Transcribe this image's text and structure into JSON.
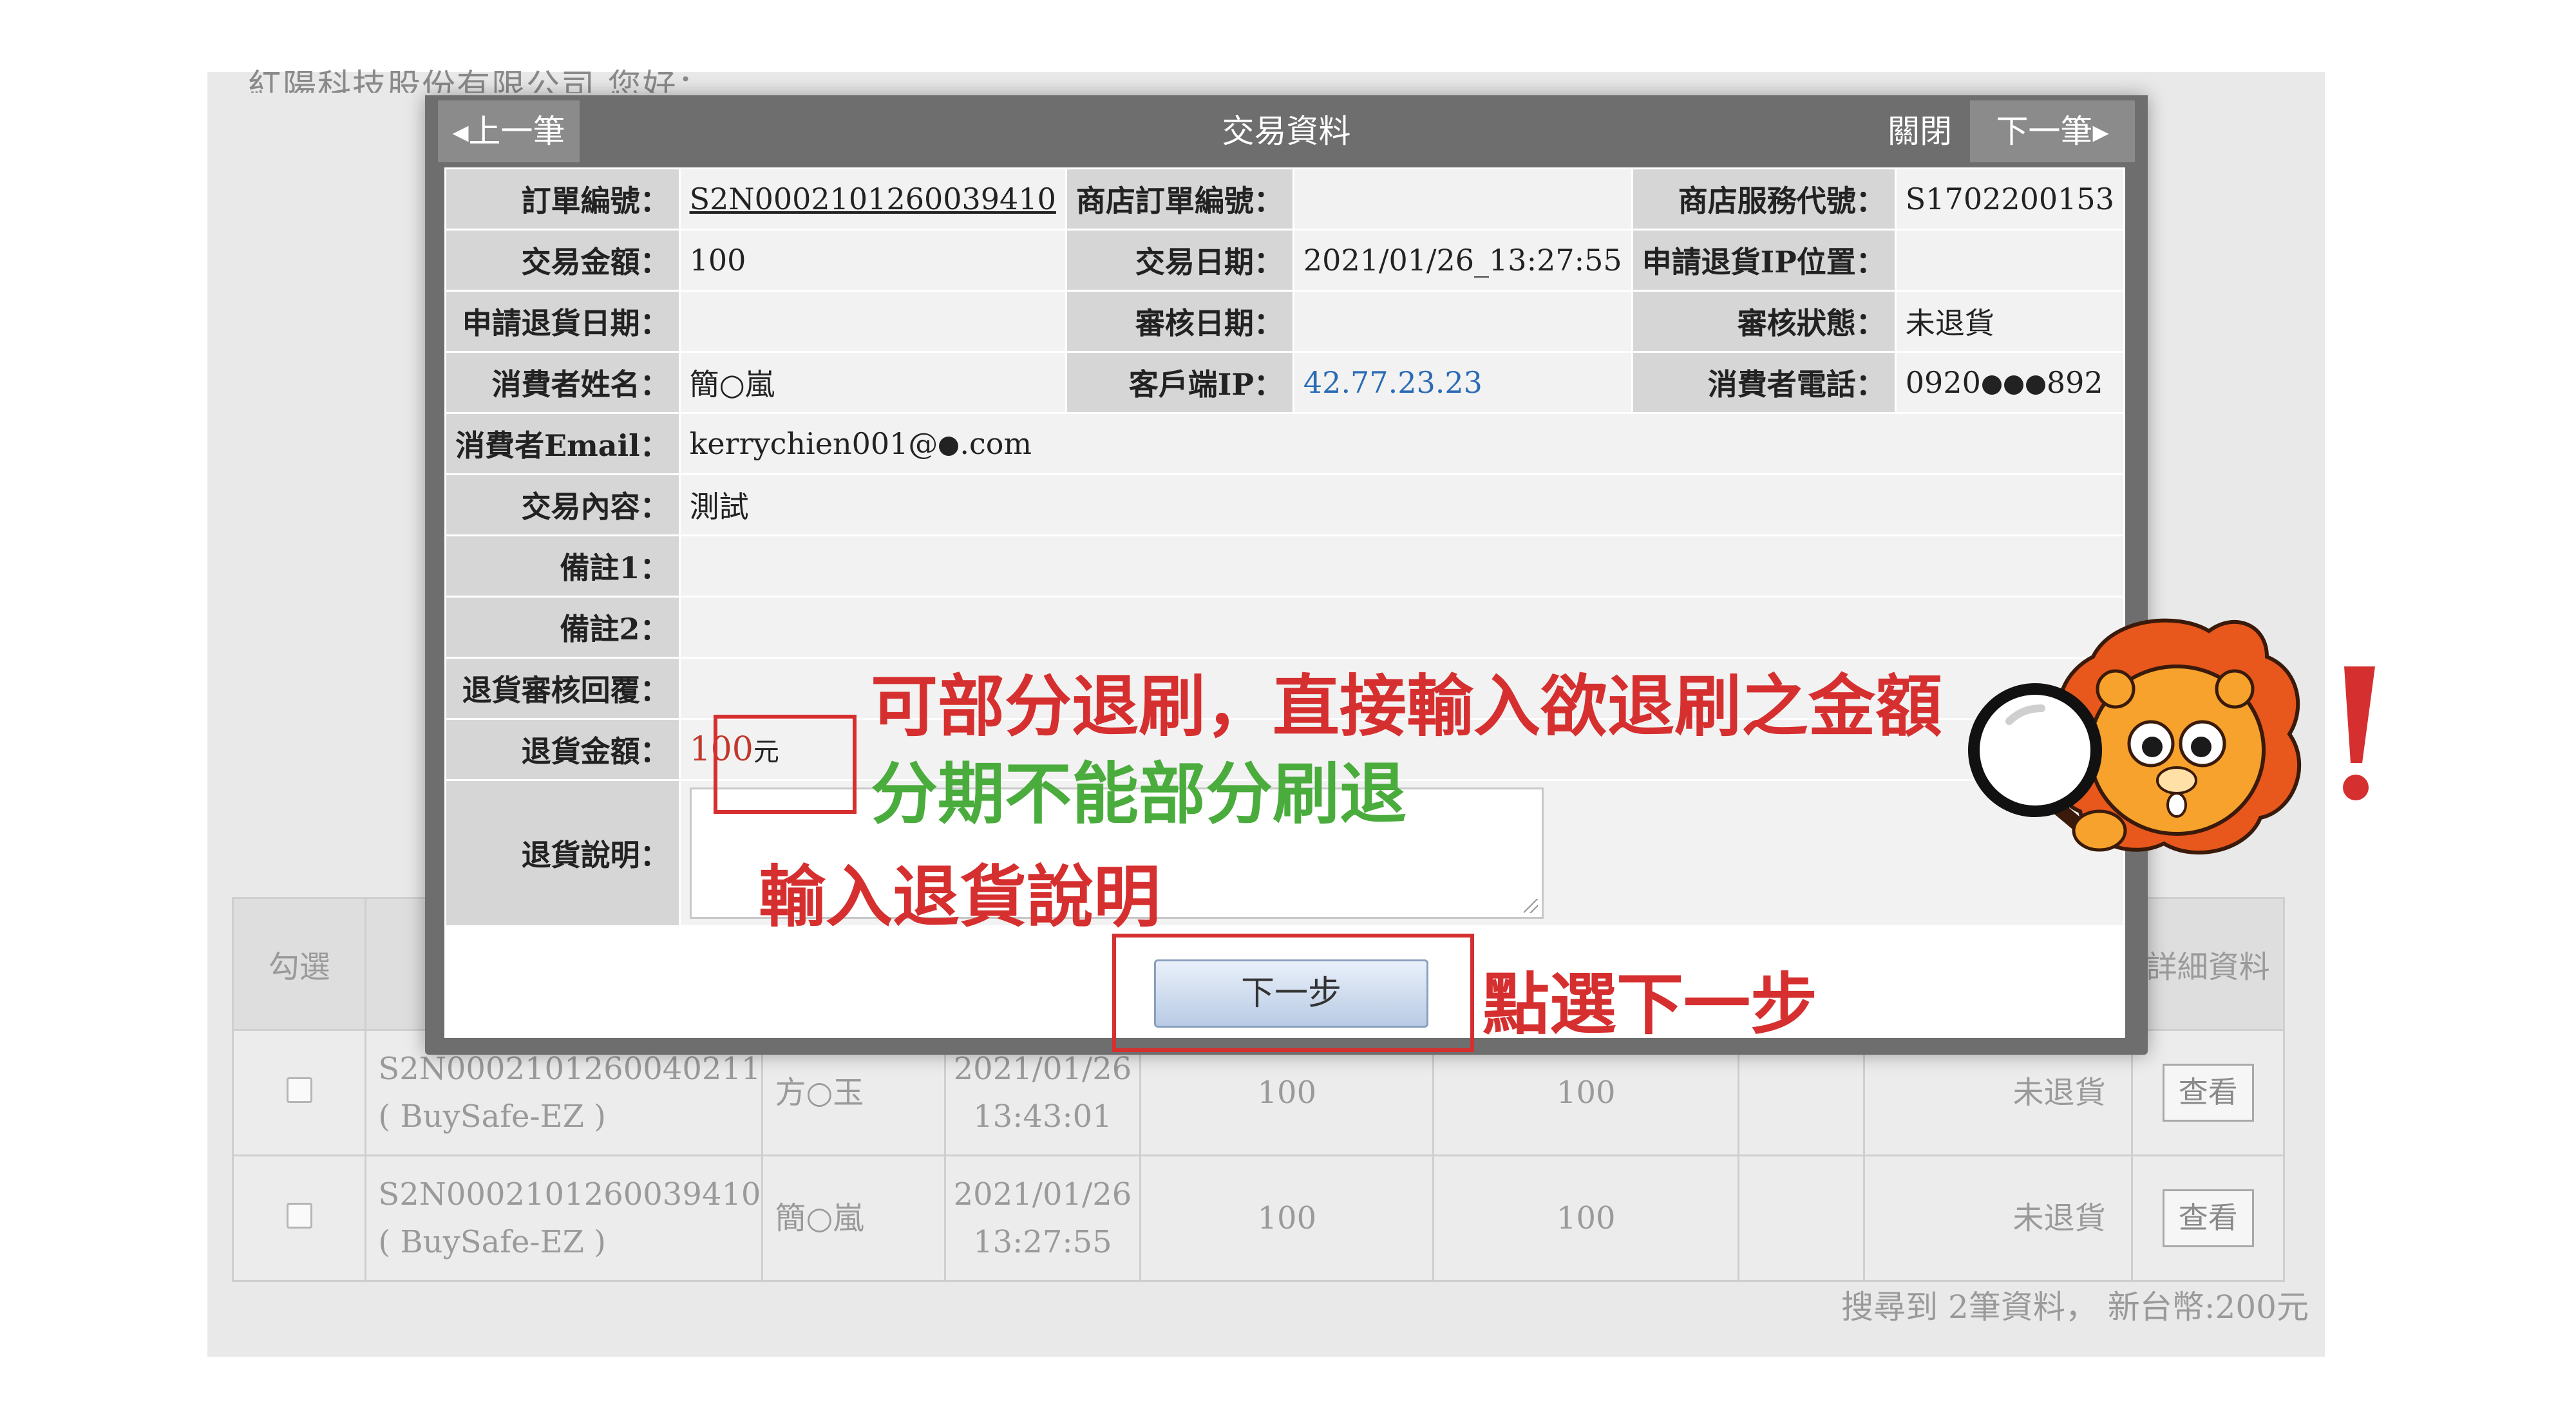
{
  "background": {
    "top_text": "紅陽科技股份有限公司 您好：",
    "table": {
      "headers": [
        "勾選",
        "詳細資料"
      ],
      "rows": [
        {
          "order_id": "S2N0002101260040211",
          "sub": "( BuySafe-EZ )",
          "name": "方○玉",
          "date": "2021/01/26",
          "time": "13:43:01",
          "amount1": "100",
          "amount2": "100",
          "status": "未退貨",
          "view": "查看"
        },
        {
          "order_id": "S2N0002101260039410",
          "sub": "( BuySafe-EZ )",
          "name": "簡○嵐",
          "date": "2021/01/26",
          "time": "13:27:55",
          "amount1": "100",
          "amount2": "100",
          "status": "未退貨",
          "view": "查看"
        }
      ]
    },
    "footer": "搜尋到 2筆資料， 新台幣:200元"
  },
  "modal": {
    "prev": "上一筆",
    "title": "交易資料",
    "close": "關閉",
    "next": "下一筆",
    "rows": {
      "order_no_label": "訂單編號：",
      "order_no": "S2N0002101260039410",
      "shop_order_label": "商店訂單編號：",
      "shop_order": "",
      "service_code_label": "商店服務代號：",
      "service_code": "S1702200153",
      "amount_label": "交易金額：",
      "amount": "100",
      "date_label": "交易日期：",
      "date": "2021/01/26_13:27:55",
      "refund_ip_label": "申請退貨IP位置：",
      "refund_ip": "",
      "refund_date_label": "申請退貨日期：",
      "refund_date": "",
      "review_date_label": "審核日期：",
      "review_date": "",
      "review_status_label": "審核狀態：",
      "review_status": "未退貨",
      "consumer_name_label": "消費者姓名：",
      "consumer_name": "簡○嵐",
      "client_ip_label": "客戶端IP：",
      "client_ip": "42.77.23.23",
      "phone_label": "消費者電話：",
      "phone_prefix": "0920",
      "phone_suffix": "892",
      "email_label": "消費者Email：",
      "email_prefix": "kerrychien001@",
      "email_suffix": ".com",
      "content_label": "交易內容：",
      "content": "測試",
      "note1_label": "備註1：",
      "note1": "",
      "note2_label": "備註2：",
      "note2": "",
      "refund_reply_label": "退貨審核回覆：",
      "refund_reply": "",
      "refund_amount_label": "退貨金額：",
      "refund_amount": "100",
      "refund_unit": "元",
      "refund_desc_label": "退貨說明："
    },
    "next_step": "下一步"
  },
  "annotations": {
    "partial_refund": "可部分退刷，直接輸入欲退刷之金額",
    "installment": "分期不能部分刷退",
    "enter_desc": "輸入退貨說明",
    "click_next": "點選下一步"
  },
  "colors": {
    "annotation_red": "#d62f2f",
    "annotation_green": "#4aac3c",
    "mascot_orange": "#e8571c"
  }
}
